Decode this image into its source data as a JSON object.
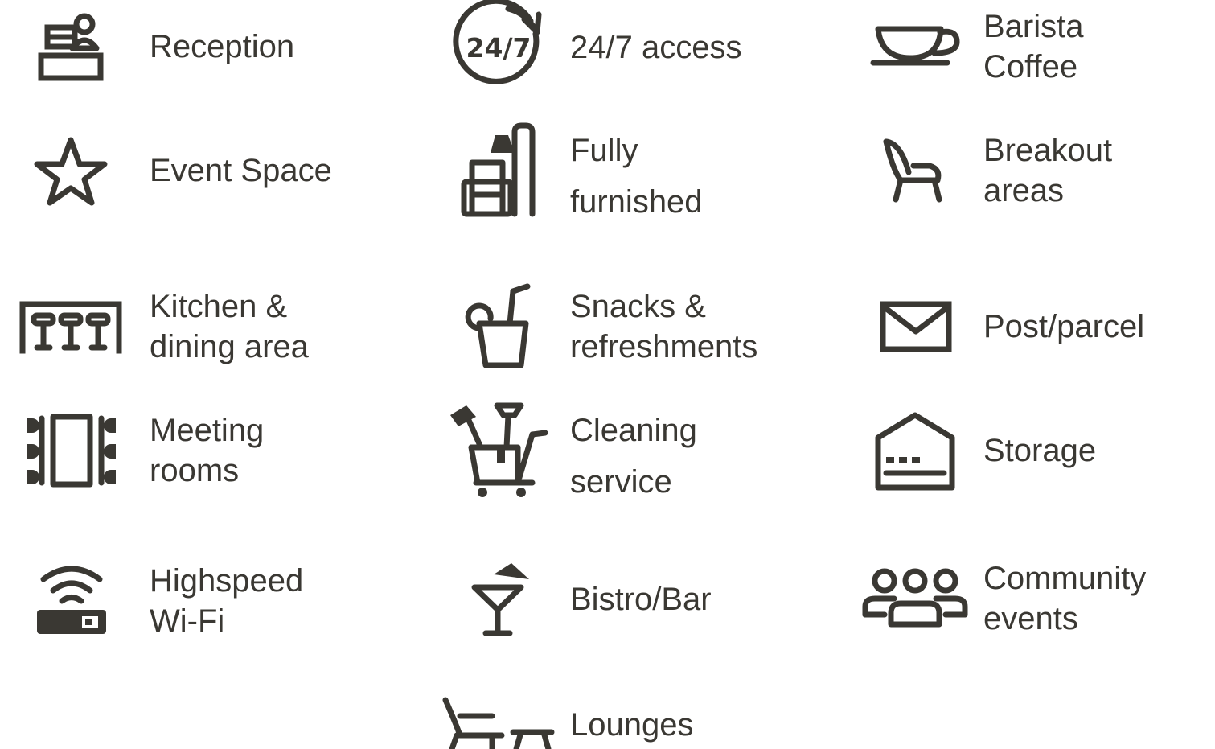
{
  "theme": {
    "text_color": "#3a3833",
    "icon_color": "#3a3833",
    "background": "#ffffff"
  },
  "amenities": {
    "reception": {
      "icon": "reception-desk-icon",
      "lines": [
        "Reception"
      ]
    },
    "access_24_7": {
      "icon": "clock-24-7-icon",
      "icon_text": "24/7",
      "lines": [
        "24/7 access"
      ]
    },
    "barista_coffee": {
      "icon": "coffee-cup-icon",
      "lines": [
        "Barista",
        "Coffee"
      ]
    },
    "event_space": {
      "icon": "star-icon",
      "lines": [
        "Event Space"
      ]
    },
    "fully_furnished": {
      "icon": "armchair-lamp-icon",
      "lines": [
        "Fully",
        "furnished"
      ]
    },
    "breakout_areas": {
      "icon": "lounge-chair-icon",
      "lines": [
        "Breakout",
        "areas"
      ]
    },
    "kitchen_dining": {
      "icon": "bar-stools-icon",
      "lines": [
        "Kitchen &",
        "dining area"
      ]
    },
    "snacks": {
      "icon": "drink-cup-icon",
      "lines": [
        "Snacks &",
        "refreshments"
      ]
    },
    "post_parcel": {
      "icon": "envelope-icon",
      "lines": [
        "Post/parcel"
      ]
    },
    "meeting_rooms": {
      "icon": "meeting-table-icon",
      "lines": [
        "Meeting",
        "rooms"
      ]
    },
    "cleaning": {
      "icon": "cleaning-cart-icon",
      "lines": [
        "Cleaning",
        "service"
      ]
    },
    "storage": {
      "icon": "storage-house-icon",
      "lines": [
        "Storage"
      ]
    },
    "wifi": {
      "icon": "wifi-router-icon",
      "lines": [
        "Highspeed",
        "Wi-Fi"
      ]
    },
    "bistro_bar": {
      "icon": "cocktail-glass-icon",
      "lines": [
        "Bistro/Bar"
      ]
    },
    "community_events": {
      "icon": "people-group-icon",
      "lines": [
        "Community",
        "events"
      ]
    },
    "lounges": {
      "icon": "lounge-chair-table-icon",
      "lines": [
        "Lounges"
      ]
    }
  }
}
